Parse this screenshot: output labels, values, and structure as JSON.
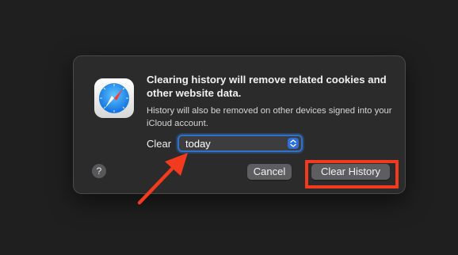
{
  "dialog": {
    "title": "Clearing history will remove related cookies and other website data.",
    "subtitle": "History will also be removed on other devices signed into your iCloud account.",
    "clear_label": "Clear",
    "select": {
      "value": "today",
      "stepper_icon": "chevron-up-down-icon"
    },
    "help_label": "?",
    "cancel_label": "Cancel",
    "clear_history_label": "Clear History",
    "app_icon": "safari-compass-icon"
  },
  "annotations": {
    "color": "#f23a1f",
    "arrow_icon": "red-arrow",
    "highlight": "clear-history-button"
  },
  "colors": {
    "accent": "#2f72c9",
    "dialog_bg": "#2b2b2c",
    "page_bg": "#1f1f1f"
  }
}
